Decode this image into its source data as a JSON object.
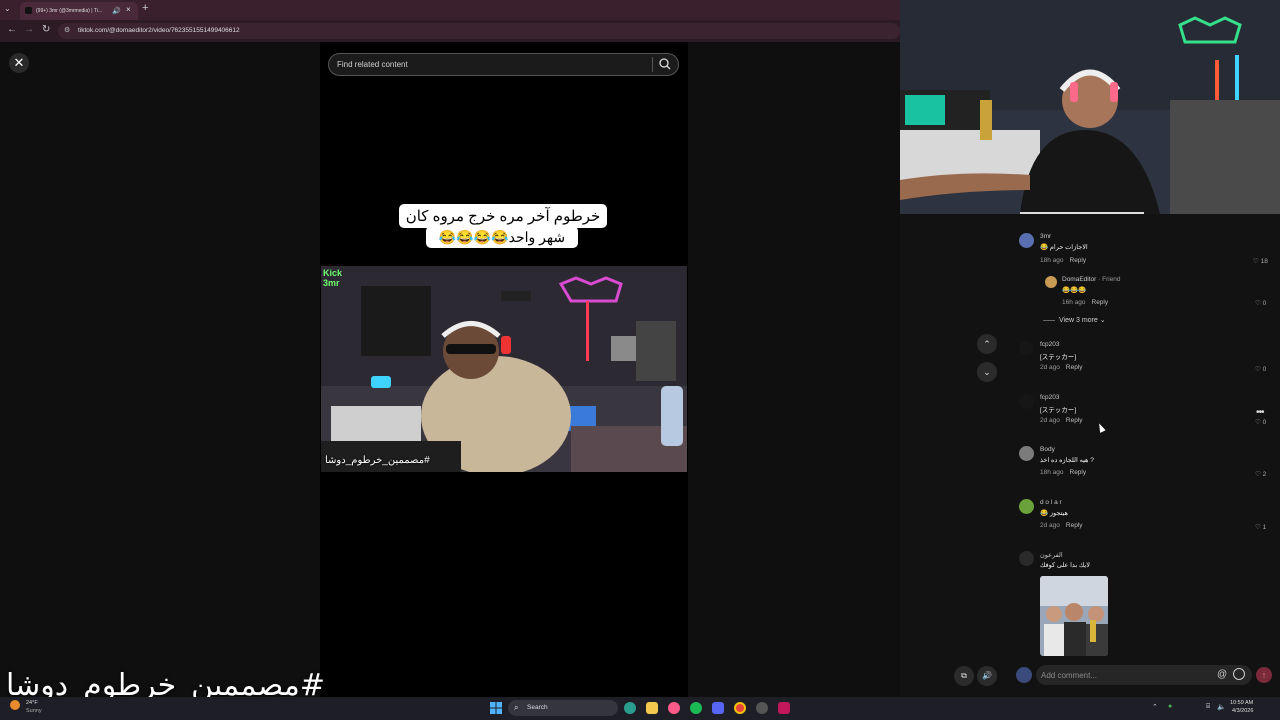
{
  "browser": {
    "tab_title": "(99+) 3mr (@3mrmedia) | Ti...",
    "url": "tiktok.com/@domaeditor2/video/7623551551499406612"
  },
  "search": {
    "placeholder": "Find related content"
  },
  "video": {
    "caption_line1": "خرطوم آخر مره خرج مروه كان",
    "caption_line2": "شهر واحد😂😂😂😂",
    "watermark": "#مصممين_خرطوم_دوشا",
    "logo_line1": "Kick",
    "logo_line2": "3mr"
  },
  "comments": [
    {
      "user": "3mr",
      "text": "😂 الاجازات حرام",
      "time": "18h ago",
      "reply": "Reply",
      "likes": "18",
      "avatar_color": "#5a6fb0"
    },
    {
      "user": "DomaEditor",
      "badge": "· Friend",
      "text": "😂😂😂",
      "time": "16h ago",
      "reply": "Reply",
      "likes": "0",
      "avatar_color": "#c79a55"
    },
    {
      "user": "fcp203",
      "text": "[ステッカー]",
      "time": "2d ago",
      "reply": "Reply",
      "likes": "0",
      "avatar_color": "#161616"
    },
    {
      "user": "fcp203",
      "text": "[ステッカー]",
      "time": "2d ago",
      "reply": "Reply",
      "likes": "0",
      "avatar_color": "#161616"
    },
    {
      "user": "Body",
      "text": "هيه اللجازه ده اخذ ?",
      "time": "18h ago",
      "reply": "Reply",
      "likes": "2",
      "avatar_color": "#7c7c7c"
    },
    {
      "user": "d o l a r",
      "text": "😂 هيتجوز",
      "time": "2d ago",
      "reply": "Reply",
      "likes": "1",
      "avatar_color": "#6aa13a"
    },
    {
      "user": "الفرعون",
      "text": "لايك بدا على كوفك",
      "time": "",
      "reply": "",
      "likes": "",
      "avatar_color": "#2a2a2a"
    }
  ],
  "view_more": "View 3 more",
  "add_comment": {
    "placeholder": "Add comment..."
  },
  "overlay": {
    "hashtag": "#مصممين_خرطوم_دوشا"
  },
  "taskbar": {
    "weather_temp": "24°F",
    "weather_desc": "Sunny",
    "search_label": "Search",
    "time": "10:59 AM",
    "date": "4/3/2026"
  },
  "colors": {
    "tiktok_bg": "#000000",
    "browser_tab": "#3a1f2d",
    "send_button": "#7a2a3a"
  }
}
